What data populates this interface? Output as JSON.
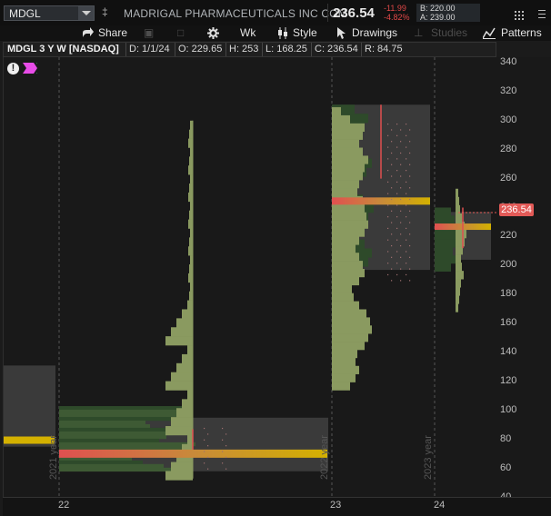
{
  "topbar": {
    "symbol": "MDGL",
    "company": "MADRIGAL PHARMACEUTICALS INC COM",
    "last": "236.54",
    "change": "-11.99",
    "change_pct": "-4.82%",
    "bid": "B: 220.00",
    "ask": "A: 239.00"
  },
  "toolbar": {
    "share": "Share",
    "wk": "Wk",
    "style": "Style",
    "drawings": "Drawings",
    "studies": "Studies",
    "patterns": "Patterns"
  },
  "chart_header": {
    "title": "MDGL 3 Y W [NASDAQ]",
    "date": "D: 1/1/24",
    "open": "O: 229.65",
    "high": "H: 253",
    "low": "L: 168.25",
    "close": "C: 236.54",
    "range": "R: 84.75"
  },
  "chart": {
    "alert": "!",
    "price_tag": "236.54",
    "year_labels": [
      "2021 year",
      "2022 year",
      "2023 year"
    ],
    "x_ticks": [
      "22",
      "23",
      "24"
    ],
    "colors": {
      "pos_green": "#8a9a60",
      "neg_green": "#2e4a2a",
      "value_area": "#3a3a3a",
      "poc_red": "#e05050",
      "poc_gold": "#d4b100",
      "accent_red": "#e25a57"
    }
  },
  "chart_data": {
    "type": "volume-profile",
    "y_ticks": [
      "340",
      "320",
      "300",
      "280",
      "260",
      "240",
      "220",
      "200",
      "180",
      "160",
      "140",
      "120",
      "100",
      "80",
      "60",
      "40"
    ],
    "ylim": [
      40,
      340
    ],
    "profiles": [
      {
        "label": "2021",
        "poc": 80,
        "value_area": [
          75,
          131
        ],
        "range": [
          72,
          131
        ]
      },
      {
        "label": "2022",
        "poc": 70,
        "value_area": [
          58,
          95
        ],
        "range": [
          53,
          300
        ]
      },
      {
        "label": "2023",
        "poc": 244,
        "value_area": [
          197,
          311
        ],
        "range": [
          114,
          326
        ]
      },
      {
        "label": "2024",
        "poc": 226,
        "value_area": [
          204,
          237
        ],
        "range": [
          168.25,
          253
        ]
      }
    ]
  }
}
